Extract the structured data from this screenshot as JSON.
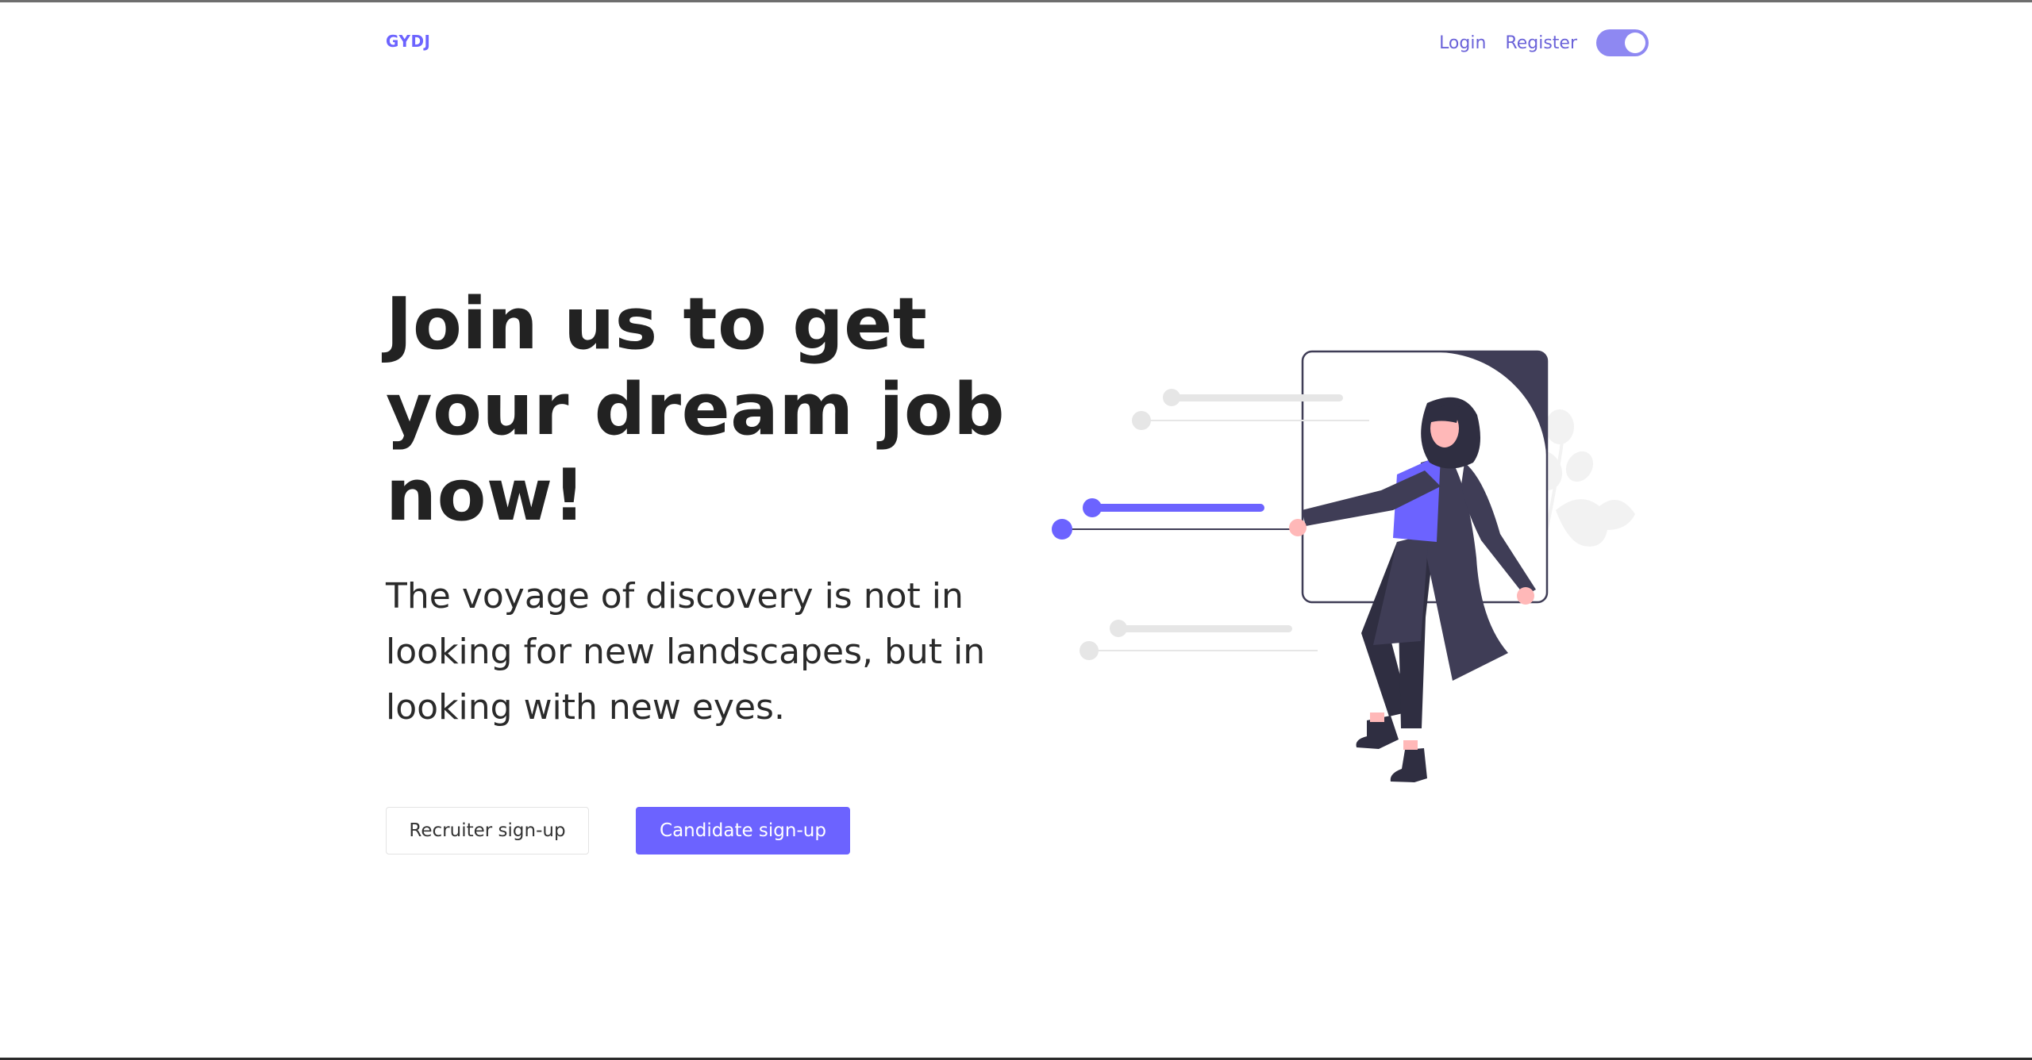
{
  "nav": {
    "brand": "GYDJ",
    "login": "Login",
    "register": "Register",
    "theme_toggle_on": true
  },
  "hero": {
    "headline": "Join us to get your dream job now!",
    "tagline": "The voyage of discovery is not in looking for new landscapes, but in looking with new eyes.",
    "recruiter_button": "Recruiter sign-up",
    "candidate_button": "Candidate sign-up"
  },
  "colors": {
    "accent": "#6c63ff",
    "toggle": "#8e88f2",
    "dark": "#3f3d56",
    "text": "#222222"
  },
  "icons": {
    "theme_toggle": "toggle-switch-icon",
    "illustration": "woman-pulling-slider-illustration"
  }
}
